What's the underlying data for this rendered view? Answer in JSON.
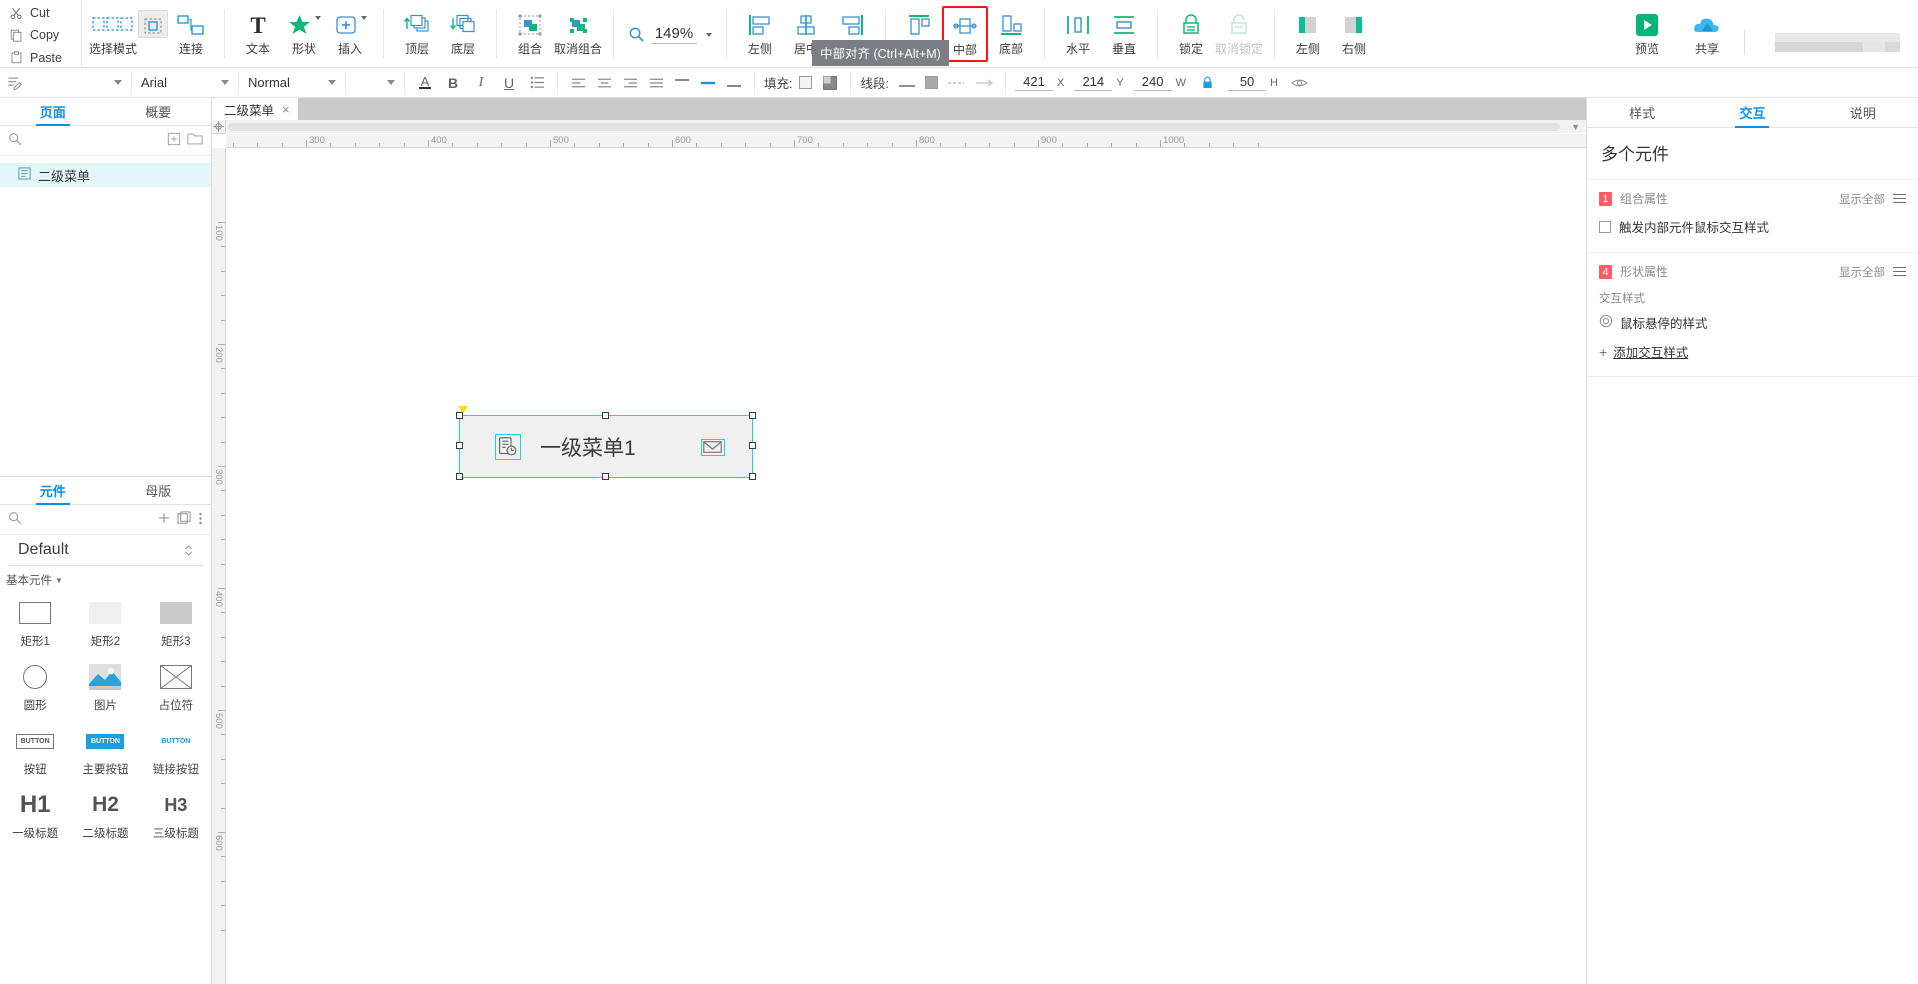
{
  "toolbar": {
    "clipboard": [
      {
        "label": "Cut",
        "icon": "scissors-icon"
      },
      {
        "label": "Copy",
        "icon": "copy-icon"
      },
      {
        "label": "Paste",
        "icon": "clipboard-icon"
      }
    ],
    "groups": [
      {
        "items": [
          {
            "label": "选择模式",
            "icon": "select-mode-icon",
            "dropdown": false,
            "active": false
          },
          {
            "label": "连接",
            "icon": "connect-icon",
            "dropdown": false,
            "active": false
          }
        ]
      },
      {
        "items": [
          {
            "label": "文本",
            "icon": "text-icon",
            "dropdown": false
          },
          {
            "label": "形状",
            "icon": "shape-star-icon",
            "dropdown": true
          },
          {
            "label": "插入",
            "icon": "insert-plus-icon",
            "dropdown": true
          }
        ]
      },
      {
        "items": [
          {
            "label": "顶层",
            "icon": "bring-to-front-icon"
          },
          {
            "label": "底层",
            "icon": "send-to-back-icon"
          }
        ]
      },
      {
        "items": [
          {
            "label": "组合",
            "icon": "group-icon"
          },
          {
            "label": "取消组合",
            "icon": "ungroup-icon"
          }
        ]
      }
    ],
    "zoom": {
      "label": "149%",
      "icon": "magnifier-icon"
    },
    "align_groups": [
      {
        "items": [
          {
            "label": "左侧",
            "icon": "align-left-icon"
          },
          {
            "label": "居中",
            "icon": "align-center-h-icon"
          },
          {
            "label": "右侧",
            "icon": "align-right-icon"
          }
        ]
      },
      {
        "items": [
          {
            "label": "顶部",
            "icon": "align-top-icon",
            "highlight": false
          },
          {
            "label": "中部",
            "icon": "align-middle-icon",
            "highlight": true
          },
          {
            "label": "底部",
            "icon": "align-bottom-icon",
            "highlight": false
          }
        ]
      },
      {
        "items": [
          {
            "label": "水平",
            "icon": "distribute-horizontal-icon"
          },
          {
            "label": "垂直",
            "icon": "distribute-vertical-icon"
          }
        ]
      },
      {
        "items": [
          {
            "label": "锁定",
            "icon": "lock-icon",
            "disabled": false
          },
          {
            "label": "取消锁定",
            "icon": "unlock-icon",
            "disabled": true
          }
        ]
      },
      {
        "items": [
          {
            "label": "左侧",
            "icon": "pin-left-icon"
          },
          {
            "label": "右侧",
            "icon": "pin-right-icon"
          }
        ]
      }
    ],
    "right_actions": [
      {
        "label": "预览",
        "icon": "preview-play-icon",
        "color": "#00b578"
      },
      {
        "label": "共享",
        "icon": "share-cloud-icon",
        "color": "#29a9e8"
      }
    ],
    "tooltip": "中部对齐 (Ctrl+Alt+M)"
  },
  "format_bar": {
    "style_select": {
      "value": "",
      "icon": "style-edit-icon"
    },
    "font_family": "Arial",
    "font_style": "Normal",
    "font_size": "",
    "text_buttons": [
      {
        "name": "font-color-icon",
        "label": "A"
      },
      {
        "name": "bold-icon",
        "label": "B"
      },
      {
        "name": "italic-icon",
        "label": "I"
      },
      {
        "name": "underline-icon",
        "label": "U"
      },
      {
        "name": "list-icon",
        "label": "≔"
      }
    ],
    "fill_label": "填充:",
    "line_label": "线段:",
    "position": {
      "x_value": "421",
      "x_label": "X",
      "y_value": "214",
      "y_label": "Y",
      "w_value": "240",
      "w_label": "W",
      "h_value": "50",
      "h_label": "H",
      "lock_icon": "lock-ratio-icon",
      "eye_icon": "visibility-icon"
    }
  },
  "left_panel": {
    "tabs": [
      {
        "label": "页面",
        "active": true
      },
      {
        "label": "概要",
        "active": false
      }
    ],
    "toolbar_icons": [
      "search-icon",
      "add-page-icon",
      "add-folder-icon"
    ],
    "pages": [
      {
        "label": "二级菜单",
        "icon": "page-icon",
        "selected": true
      }
    ],
    "widget_tabs": [
      {
        "label": "元件",
        "active": true
      },
      {
        "label": "母版",
        "active": false
      }
    ],
    "widget_toolbar_icons": [
      "search-icon",
      "plus-icon",
      "library-icon",
      "more-icon"
    ],
    "library_name": "Default",
    "section_title": "基本元件",
    "widgets": [
      {
        "label": "矩形1",
        "icon": "rectangle-outline-icon"
      },
      {
        "label": "矩形2",
        "icon": "rectangle-light-icon"
      },
      {
        "label": "矩形3",
        "icon": "rectangle-gray-icon"
      },
      {
        "label": "圆形",
        "icon": "circle-icon"
      },
      {
        "label": "图片",
        "icon": "image-icon"
      },
      {
        "label": "占位符",
        "icon": "placeholder-icon"
      },
      {
        "label": "按钮",
        "icon": "button-icon"
      },
      {
        "label": "主要按钮",
        "icon": "primary-button-icon"
      },
      {
        "label": "链接按钮",
        "icon": "link-button-icon"
      },
      {
        "label": "一级标题",
        "icon": "h1-icon",
        "sample": "H1"
      },
      {
        "label": "二级标题",
        "icon": "h2-icon",
        "sample": "H2"
      },
      {
        "label": "三级标题",
        "icon": "h3-icon",
        "sample": "H3"
      }
    ]
  },
  "canvas": {
    "tab": {
      "label": "二级菜单",
      "close": "×"
    },
    "ruler_h_labels": [
      "300",
      "400",
      "500",
      "600",
      "700",
      "800",
      "900",
      "1000"
    ],
    "ruler_v_labels": [
      "100",
      "200",
      "300",
      "400",
      "500",
      "600"
    ],
    "selected_element": {
      "text": "一级菜单1",
      "left_icon": "clipboard-clock-icon",
      "right_icon": "envelope-icon"
    }
  },
  "right_panel": {
    "tabs": [
      {
        "label": "样式",
        "active": false
      },
      {
        "label": "交互",
        "active": true
      },
      {
        "label": "说明",
        "active": false
      }
    ],
    "title": "多个元件",
    "sections": [
      {
        "badge": "1",
        "label": "组合属性",
        "show_all": "显示全部",
        "menu_icon": "hamburger-icon",
        "checkbox": {
          "label": "触发内部元件鼠标交互样式",
          "checked": false
        }
      },
      {
        "badge": "4",
        "label": "形状属性",
        "show_all": "显示全部",
        "menu_icon": "hamburger-icon",
        "sub_label": "交互样式",
        "interaction_styles": [
          {
            "label": "鼠标悬停的样式",
            "icon": "target-circle-icon"
          }
        ],
        "add_label": "添加交互样式"
      }
    ]
  },
  "colors": {
    "accent_blue": "#0d8fe8",
    "teal": "#19d6d6",
    "green": "#00b578",
    "red_highlight": "#ff1414",
    "badge_red": "#ff5e62"
  }
}
